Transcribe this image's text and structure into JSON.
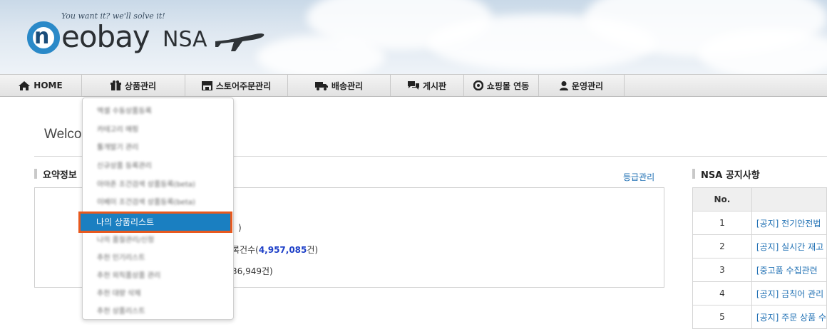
{
  "header": {
    "slogan": "You want it?   we'll solve it!",
    "logo_letter": "n",
    "logo_text": "eobay",
    "logo_suffix": "NSA"
  },
  "nav": {
    "items": [
      {
        "label": "HOME",
        "icon": "home-icon"
      },
      {
        "label": "상품관리",
        "icon": "gift-icon"
      },
      {
        "label": "스토어주문관리",
        "icon": "store-icon"
      },
      {
        "label": "배송관리",
        "icon": "truck-icon"
      },
      {
        "label": "게시판",
        "icon": "chat-icon"
      },
      {
        "label": "쇼핑몰 연동",
        "icon": "sync-icon"
      },
      {
        "label": "운영관리",
        "icon": "user-icon"
      }
    ]
  },
  "dropdown": {
    "items": [
      "엑셀 수동상품등록",
      "카테고리 매핑",
      "툴개발기 관리",
      "신규상품 등록관리",
      "아마존 조건검색 상품등록(beta)",
      "이베이 조건검색 상품등록(beta)",
      "나의 상품리스트",
      "나의 품절관리/신청",
      "추천 인기리스트",
      "추천 외직품상품 관리",
      "추천 대량 삭제",
      "추천 상품리스트"
    ],
    "active_label": "나의 상품리스트"
  },
  "main": {
    "welcome": "Welco",
    "summary_title": "요약정보",
    "grade_link": "등급관리",
    "summary": {
      "line1_suffix": ")",
      "line2_prefix": "록건수(",
      "line2_value": "4,957,085",
      "line2_suffix": "건)",
      "line3_value": "36,949건)"
    }
  },
  "notice": {
    "title": "NSA 공지사항",
    "col_no": "No.",
    "rows": [
      {
        "no": "1",
        "title": "[공지] 전기안전법"
      },
      {
        "no": "2",
        "title": "[공지] 실시간 재고"
      },
      {
        "no": "3",
        "title": "[중고품 수집관련"
      },
      {
        "no": "4",
        "title": "[공지] 금칙어 관리"
      },
      {
        "no": "5",
        "title": "[공지] 주문 상품 수"
      }
    ]
  }
}
